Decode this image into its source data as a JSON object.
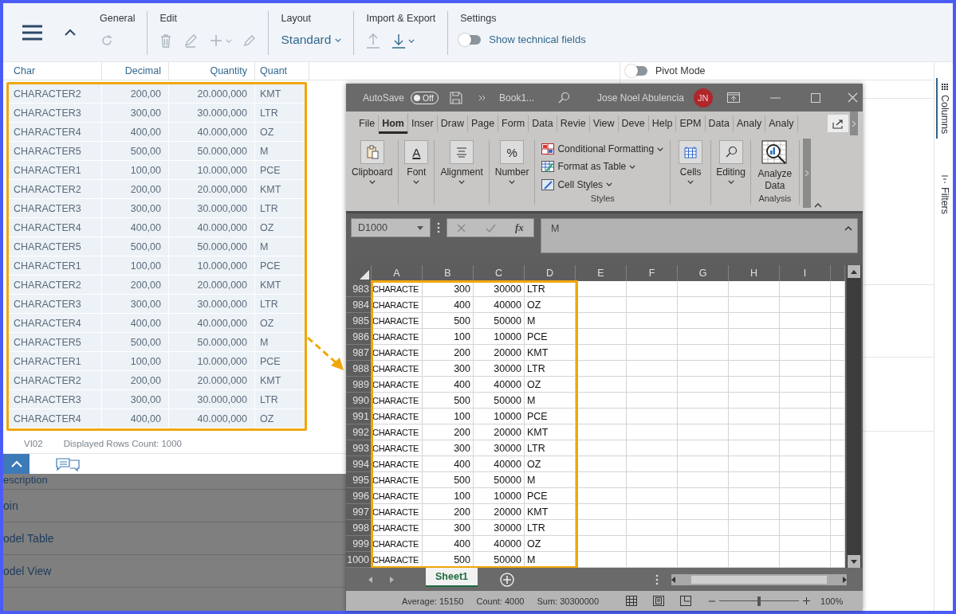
{
  "toolbar": {
    "general_label": "General",
    "edit_label": "Edit",
    "layout_label": "Layout",
    "layout_value": "Standard",
    "import_export_label": "Import & Export",
    "settings_label": "Settings",
    "technical_fields": {
      "label": "Show technical fields",
      "on": false
    }
  },
  "table": {
    "columns": [
      "Char",
      "Decimal",
      "Quantity",
      "Quant"
    ],
    "rows": [
      [
        "CHARACTER2",
        "200,00",
        "20.000,000",
        "KMT"
      ],
      [
        "CHARACTER3",
        "300,00",
        "30.000,000",
        "LTR"
      ],
      [
        "CHARACTER4",
        "400,00",
        "40.000,000",
        "OZ"
      ],
      [
        "CHARACTER5",
        "500,00",
        "50.000,000",
        "M"
      ],
      [
        "CHARACTER1",
        "100,00",
        "10.000,000",
        "PCE"
      ],
      [
        "CHARACTER2",
        "200,00",
        "20.000,000",
        "KMT"
      ],
      [
        "CHARACTER3",
        "300,00",
        "30.000,000",
        "LTR"
      ],
      [
        "CHARACTER4",
        "400,00",
        "40.000,000",
        "OZ"
      ],
      [
        "CHARACTER5",
        "500,00",
        "50.000,000",
        "M"
      ],
      [
        "CHARACTER1",
        "100,00",
        "10.000,000",
        "PCE"
      ],
      [
        "CHARACTER2",
        "200,00",
        "20.000,000",
        "KMT"
      ],
      [
        "CHARACTER3",
        "300,00",
        "30.000,000",
        "LTR"
      ],
      [
        "CHARACTER4",
        "400,00",
        "40.000,000",
        "OZ"
      ],
      [
        "CHARACTER5",
        "500,00",
        "50.000,000",
        "M"
      ],
      [
        "CHARACTER1",
        "100,00",
        "10.000,000",
        "PCE"
      ],
      [
        "CHARACTER2",
        "200,00",
        "20.000,000",
        "KMT"
      ],
      [
        "CHARACTER3",
        "300,00",
        "30.000,000",
        "LTR"
      ],
      [
        "CHARACTER4",
        "400,00",
        "40.000,000",
        "OZ"
      ]
    ]
  },
  "footer": {
    "view": "VI02",
    "row_count": "Displayed Rows Count: 1000"
  },
  "nav_list": [
    "escription",
    "oin",
    "odel Table",
    "odel View"
  ],
  "pivot_mode": {
    "label": "Pivot Mode",
    "on": false
  },
  "side_tabs": [
    {
      "label": "Columns",
      "selected": true
    },
    {
      "label": "Filters",
      "selected": false
    }
  ],
  "excel": {
    "autosave": {
      "label": "AutoSave",
      "state": "Off"
    },
    "title": "Book1...",
    "user": "Jose Noel Abulencia",
    "initials": "JN",
    "tabs": [
      {
        "label": "File",
        "selected": false
      },
      {
        "label": "Hom",
        "selected": true
      },
      {
        "label": "Inser",
        "selected": false
      },
      {
        "label": "Draw",
        "selected": false
      },
      {
        "label": "Page",
        "selected": false
      },
      {
        "label": "Form",
        "selected": false
      },
      {
        "label": "Data",
        "selected": false
      },
      {
        "label": "Revie",
        "selected": false
      },
      {
        "label": "View",
        "selected": false
      },
      {
        "label": "Deve",
        "selected": false
      },
      {
        "label": "Help",
        "selected": false
      },
      {
        "label": "EPM",
        "selected": false
      },
      {
        "label": "Data",
        "selected": false
      },
      {
        "label": "Analy",
        "selected": false
      },
      {
        "label": "Analy",
        "selected": false
      }
    ],
    "ribbon": {
      "buttons": [
        {
          "kind": "clipboard",
          "label": "Clipboard"
        },
        {
          "kind": "font",
          "label": "Font",
          "symbol": "A"
        },
        {
          "kind": "alignment",
          "label": "Alignment"
        },
        {
          "kind": "number",
          "label": "Number",
          "symbol": "%"
        }
      ],
      "styles": {
        "label": "Styles",
        "items": [
          {
            "kind": "conditional",
            "label": "Conditional Formatting"
          },
          {
            "kind": "table",
            "label": "Format as Table"
          },
          {
            "kind": "cell_styles",
            "label": "Cell Styles"
          }
        ]
      },
      "cells": "Cells",
      "editing": "Editing",
      "analyze": "Analyze Data",
      "analysis_label": "Analysis"
    },
    "name_box": "D1000",
    "function_symbol": "fx",
    "formula": "M",
    "columns": [
      "A",
      "B",
      "C",
      "D",
      "E",
      "F",
      "G",
      "H",
      "I"
    ],
    "rows": [
      {
        "row": "983",
        "cells": [
          "CHARACTE",
          "300",
          "30000",
          "LTR"
        ]
      },
      {
        "row": "984",
        "cells": [
          "CHARACTE",
          "400",
          "40000",
          "OZ"
        ]
      },
      {
        "row": "985",
        "cells": [
          "CHARACTE",
          "500",
          "50000",
          "M"
        ]
      },
      {
        "row": "986",
        "cells": [
          "CHARACTE",
          "100",
          "10000",
          "PCE"
        ]
      },
      {
        "row": "987",
        "cells": [
          "CHARACTE",
          "200",
          "20000",
          "KMT"
        ]
      },
      {
        "row": "988",
        "cells": [
          "CHARACTE",
          "300",
          "30000",
          "LTR"
        ]
      },
      {
        "row": "989",
        "cells": [
          "CHARACTE",
          "400",
          "40000",
          "OZ"
        ]
      },
      {
        "row": "990",
        "cells": [
          "CHARACTE",
          "500",
          "50000",
          "M"
        ]
      },
      {
        "row": "991",
        "cells": [
          "CHARACTE",
          "100",
          "10000",
          "PCE"
        ]
      },
      {
        "row": "992",
        "cells": [
          "CHARACTE",
          "200",
          "20000",
          "KMT"
        ]
      },
      {
        "row": "993",
        "cells": [
          "CHARACTE",
          "300",
          "30000",
          "LTR"
        ]
      },
      {
        "row": "994",
        "cells": [
          "CHARACTE",
          "400",
          "40000",
          "OZ"
        ]
      },
      {
        "row": "995",
        "cells": [
          "CHARACTE",
          "500",
          "50000",
          "M"
        ]
      },
      {
        "row": "996",
        "cells": [
          "CHARACTE",
          "100",
          "10000",
          "PCE"
        ]
      },
      {
        "row": "997",
        "cells": [
          "CHARACTE",
          "200",
          "20000",
          "KMT"
        ]
      },
      {
        "row": "998",
        "cells": [
          "CHARACTE",
          "300",
          "30000",
          "LTR"
        ]
      },
      {
        "row": "999",
        "cells": [
          "CHARACTE",
          "400",
          "40000",
          "OZ"
        ]
      },
      {
        "row": "1000",
        "cells": [
          "CHARACTE",
          "500",
          "50000",
          "M"
        ]
      }
    ],
    "sheet_tabs": [
      {
        "label": "Sheet1",
        "selected": true
      }
    ],
    "status": [
      "Average: 15150",
      "Count: 4000",
      "Sum: 30300000"
    ],
    "zoom": {
      "level": 0.5,
      "reading": "100%"
    }
  }
}
